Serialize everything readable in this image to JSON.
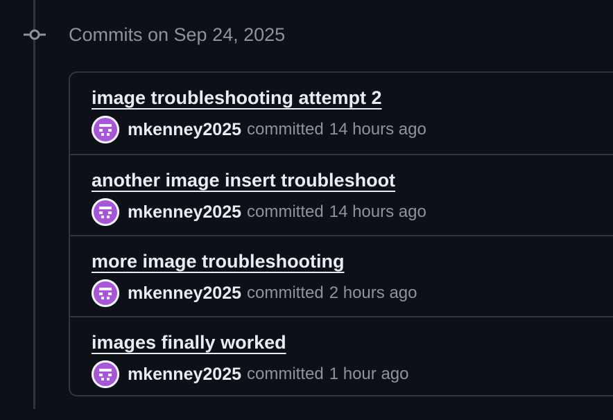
{
  "group": {
    "heading": "Commits on Sep 24, 2025"
  },
  "commits": [
    {
      "title": "image troubleshooting attempt 2",
      "author": "mkenney2025",
      "action": "committed",
      "time": "14 hours ago"
    },
    {
      "title": "another image insert troubleshoot",
      "author": "mkenney2025",
      "action": "committed",
      "time": "14 hours ago"
    },
    {
      "title": "more image troubleshooting",
      "author": "mkenney2025",
      "action": "committed",
      "time": "2 hours ago"
    },
    {
      "title": "images finally worked",
      "author": "mkenney2025",
      "action": "committed",
      "time": "1 hour ago"
    }
  ],
  "colors": {
    "background": "#0d1117",
    "border": "#30363d",
    "text_primary": "#e6edf3",
    "text_muted": "#8b949e",
    "avatar_purple": "#a855d8"
  }
}
